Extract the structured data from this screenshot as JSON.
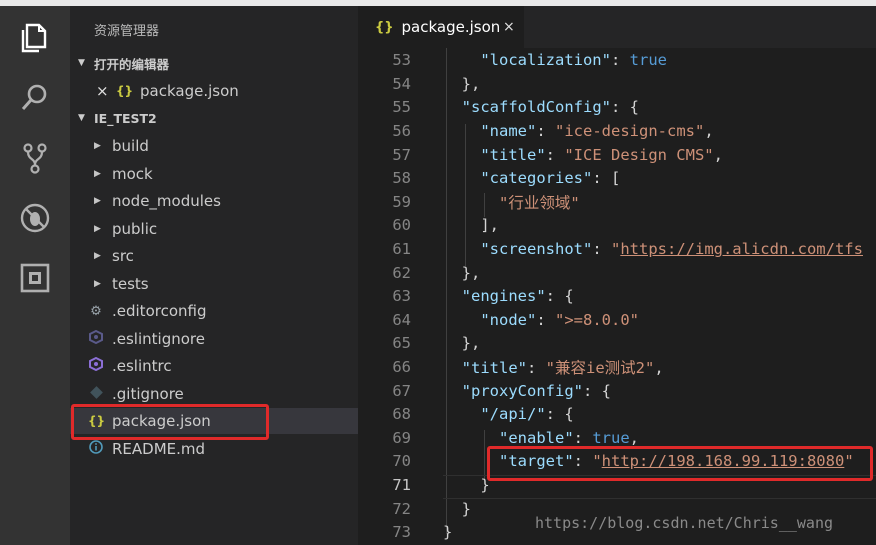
{
  "sidebar": {
    "title": "资源管理器",
    "open_editors_header": "打开的编辑器",
    "open_editors": [
      {
        "name": "package.json",
        "icon": "json-braces-icon"
      }
    ],
    "project_header": "IE_TEST2",
    "folders": [
      "build",
      "mock",
      "node_modules",
      "public",
      "src",
      "tests"
    ],
    "files": [
      {
        "name": ".editorconfig",
        "icon": "gear-icon"
      },
      {
        "name": ".eslintignore",
        "icon": "eslint-icon"
      },
      {
        "name": ".eslintrc",
        "icon": "eslint-icon"
      },
      {
        "name": ".gitignore",
        "icon": "git-icon"
      },
      {
        "name": "package.json",
        "icon": "json-braces-icon"
      },
      {
        "name": "README.md",
        "icon": "info-icon"
      }
    ],
    "icons": {
      "json_braces": "{}",
      "close": "×"
    }
  },
  "tab": {
    "label": "package.json",
    "icon": "{}",
    "close": "×"
  },
  "editor": {
    "lines": [
      {
        "n": "53",
        "tokens": [
          [
            "p",
            "    "
          ],
          [
            "k",
            "\"localization\""
          ],
          [
            "p",
            ": "
          ],
          [
            "b",
            "true"
          ]
        ]
      },
      {
        "n": "54",
        "tokens": [
          [
            "p",
            "  },"
          ]
        ]
      },
      {
        "n": "55",
        "tokens": [
          [
            "p",
            "  "
          ],
          [
            "k",
            "\"scaffoldConfig\""
          ],
          [
            "p",
            ": {"
          ]
        ]
      },
      {
        "n": "56",
        "tokens": [
          [
            "p",
            "    "
          ],
          [
            "k",
            "\"name\""
          ],
          [
            "p",
            ": "
          ],
          [
            "s",
            "\"ice-design-cms\""
          ],
          [
            "p",
            ","
          ]
        ]
      },
      {
        "n": "57",
        "tokens": [
          [
            "p",
            "    "
          ],
          [
            "k",
            "\"title\""
          ],
          [
            "p",
            ": "
          ],
          [
            "s",
            "\"ICE Design CMS\""
          ],
          [
            "p",
            ","
          ]
        ]
      },
      {
        "n": "58",
        "tokens": [
          [
            "p",
            "    "
          ],
          [
            "k",
            "\"categories\""
          ],
          [
            "p",
            ": ["
          ]
        ]
      },
      {
        "n": "59",
        "tokens": [
          [
            "p",
            "      "
          ],
          [
            "s",
            "\"行业领域\""
          ]
        ]
      },
      {
        "n": "60",
        "tokens": [
          [
            "p",
            "    ],"
          ]
        ]
      },
      {
        "n": "61",
        "tokens": [
          [
            "p",
            "    "
          ],
          [
            "k",
            "\"screenshot\""
          ],
          [
            "p",
            ": "
          ],
          [
            "s",
            "\""
          ],
          [
            "su",
            "https://img.alicdn.com/tfs"
          ]
        ]
      },
      {
        "n": "62",
        "tokens": [
          [
            "p",
            "  },"
          ]
        ]
      },
      {
        "n": "63",
        "tokens": [
          [
            "p",
            "  "
          ],
          [
            "k",
            "\"engines\""
          ],
          [
            "p",
            ": {"
          ]
        ]
      },
      {
        "n": "64",
        "tokens": [
          [
            "p",
            "    "
          ],
          [
            "k",
            "\"node\""
          ],
          [
            "p",
            ": "
          ],
          [
            "s",
            "\">=8.0.0\""
          ]
        ]
      },
      {
        "n": "65",
        "tokens": [
          [
            "p",
            "  },"
          ]
        ]
      },
      {
        "n": "66",
        "tokens": [
          [
            "p",
            "  "
          ],
          [
            "k",
            "\"title\""
          ],
          [
            "p",
            ": "
          ],
          [
            "s",
            "\"兼容ie测试2\""
          ],
          [
            "p",
            ","
          ]
        ]
      },
      {
        "n": "67",
        "tokens": [
          [
            "p",
            "  "
          ],
          [
            "k",
            "\"proxyConfig\""
          ],
          [
            "p",
            ": {"
          ]
        ]
      },
      {
        "n": "68",
        "tokens": [
          [
            "p",
            "    "
          ],
          [
            "k",
            "\"/api/\""
          ],
          [
            "p",
            ": {"
          ]
        ]
      },
      {
        "n": "69",
        "tokens": [
          [
            "p",
            "      "
          ],
          [
            "k",
            "\"enable\""
          ],
          [
            "p",
            ": "
          ],
          [
            "b",
            "true"
          ],
          [
            "p",
            ","
          ]
        ]
      },
      {
        "n": "70",
        "tokens": [
          [
            "p",
            "      "
          ],
          [
            "k",
            "\"target\""
          ],
          [
            "p",
            ": "
          ],
          [
            "s",
            "\""
          ],
          [
            "su",
            "http://198.168.99.119:8080"
          ],
          [
            "s",
            "\""
          ]
        ]
      },
      {
        "n": "71",
        "tokens": [
          [
            "p",
            "    }"
          ]
        ]
      },
      {
        "n": "72",
        "tokens": [
          [
            "p",
            "  }"
          ]
        ]
      },
      {
        "n": "73",
        "tokens": [
          [
            "p",
            "}"
          ]
        ]
      }
    ],
    "active_line": "71"
  },
  "watermark": "https://blog.csdn.net/Chris__wang",
  "colors": {
    "highlight": "#e02a2a",
    "json_icon": "#cbcb41",
    "key": "#9cdcfe",
    "string": "#ce9178",
    "bool": "#569cd6"
  }
}
